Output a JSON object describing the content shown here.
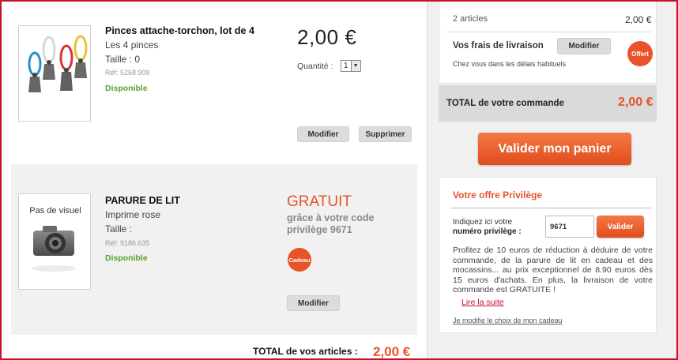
{
  "products": [
    {
      "title": "Pinces attache-torchon, lot de 4",
      "subtitle": "Les 4 pinces",
      "size": "Taille : 0",
      "ref": "Réf: 5268.909",
      "availability": "Disponible",
      "price": "2,00 €",
      "quantity_label": "Quantité :",
      "quantity_value": "1",
      "modify_label": "Modifier",
      "delete_label": "Supprimer"
    },
    {
      "title": "PARURE DE LIT",
      "subtitle": "Imprime rose",
      "size": "Taille :",
      "ref": "Réf: 9186.635",
      "availability": "Disponible",
      "thumb_text": "Pas de visuel",
      "free_label": "GRATUIT",
      "free_sub": "grâce à votre code privilège 9671",
      "gift_badge": "Cadeau",
      "modify_label": "Modifier"
    }
  ],
  "totals": {
    "articles_label": "TOTAL de vos articles :",
    "articles_value": "2,00 €"
  },
  "summary": {
    "articles_count": "2 articles",
    "articles_price": "2,00 €",
    "shipping_label": "Vos frais de livraison",
    "shipping_modify": "Modifier",
    "shipping_note": "Chez vous dans les délais habituels",
    "shipping_badge": "Offert",
    "order_total_label": "TOTAL de votre commande",
    "order_total_value": "2,00 €",
    "validate_button": "Valider mon panier"
  },
  "privilege": {
    "title": "Votre offre Privilège",
    "prompt_line1": "Indiquez ici votre",
    "prompt_line2": "numéro privilège :",
    "code_value": "9671",
    "validate_label": "Valider",
    "description": "Profitez de 10 euros de réduction à déduire de votre commande, de la parure de lit en cadeau et des mocassins... au prix exceptionnel de 8.90 euros dès 15 euros d'achats. En plus, la livraison de votre commande est GRATUITE !",
    "read_more": "Lire la suite",
    "change_gift": "Je modifie le choix de mon cadeau"
  },
  "colors": {
    "accent": "#e8532a",
    "available": "#5aa02c",
    "frame": "#c8102e"
  }
}
